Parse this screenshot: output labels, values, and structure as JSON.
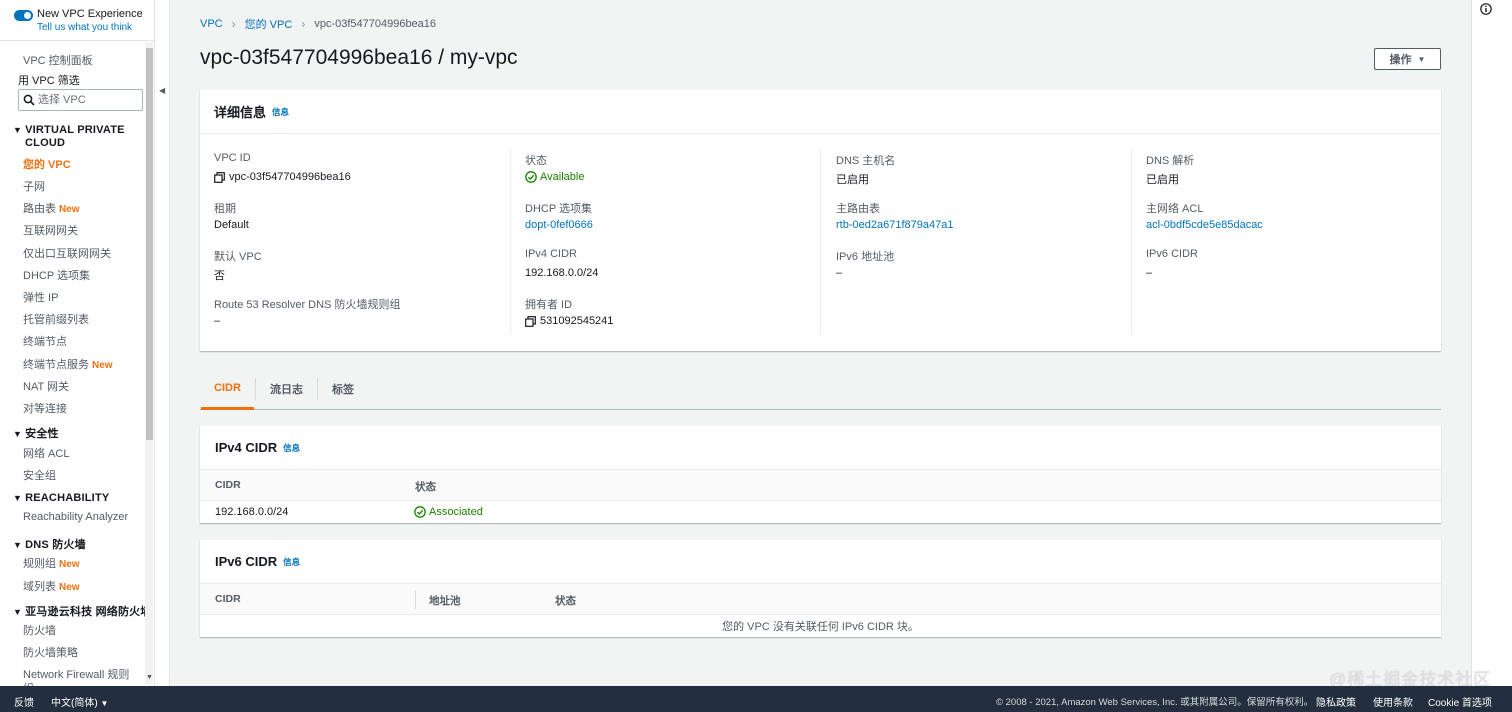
{
  "sidebar": {
    "toggle_title": "New VPC Experience",
    "toggle_sub": "Tell us what you think",
    "dashboard": "VPC 控制面板",
    "filter_label": "用 VPC 筛选",
    "search_placeholder": "选择 VPC",
    "section_vpc": "VIRTUAL PRIVATE",
    "section_vpc2": "CLOUD",
    "items_vpc": [
      "您的 VPC",
      "子网",
      "路由表",
      "互联网网关",
      "仅出口互联网网关",
      "DHCP 选项集",
      "弹性 IP",
      "托管前缀列表",
      "终端节点",
      "终端节点服务",
      "NAT 网关",
      "对等连接"
    ],
    "new_badge": "New",
    "section_security": "安全性",
    "items_security": [
      "网络 ACL",
      "安全组"
    ],
    "section_reach": "REACHABILITY",
    "items_reach": [
      "Reachability Analyzer"
    ],
    "section_dns": "DNS 防火墙",
    "items_dns": [
      "规则组",
      "域列表"
    ],
    "section_nfw": "亚马逊云科技 网络防火墙",
    "items_nfw": [
      "防火墙",
      "防火墙策略",
      "Network Firewall 规则",
      "组"
    ]
  },
  "breadcrumb": [
    "VPC",
    "您的 VPC",
    "vpc-03f547704996bea16"
  ],
  "page_title": "vpc-03f547704996bea16 / my-vpc",
  "actions_label": "操作",
  "details": {
    "title": "详细信息",
    "info": "信息",
    "vpc_id_label": "VPC ID",
    "vpc_id": "vpc-03f547704996bea16",
    "tenancy_label": "租期",
    "tenancy": "Default",
    "default_vpc_label": "默认 VPC",
    "default_vpc": "否",
    "route53_label": "Route 53 Resolver DNS 防火墙规则组",
    "route53": "–",
    "state_label": "状态",
    "state": "Available",
    "dhcp_label": "DHCP 选项集",
    "dhcp": "dopt-0fef0666",
    "ipv4_label": "IPv4 CIDR",
    "ipv4": "192.168.0.0/24",
    "owner_label": "拥有者 ID",
    "owner": "531092545241",
    "dns_host_label": "DNS 主机名",
    "dns_host": "已启用",
    "main_rt_label": "主路由表",
    "main_rt": "rtb-0ed2a671f879a47a1",
    "ipv6_pool_label": "IPv6 地址池",
    "ipv6_pool": "–",
    "dns_res_label": "DNS 解析",
    "dns_res": "已启用",
    "main_acl_label": "主网络 ACL",
    "main_acl": "acl-0bdf5cde5e85dacac",
    "ipv6_cidr_label": "IPv6 CIDR",
    "ipv6_cidr": "–"
  },
  "tabs": [
    "CIDR",
    "流日志",
    "标签"
  ],
  "ipv4_table": {
    "title": "IPv4 CIDR",
    "info": "信息",
    "headers": [
      "CIDR",
      "状态"
    ],
    "rows": [
      {
        "cidr": "192.168.0.0/24",
        "status": "Associated"
      }
    ]
  },
  "ipv6_table": {
    "title": "IPv6 CIDR",
    "info": "信息",
    "headers": [
      "CIDR",
      "地址池",
      "状态"
    ],
    "empty": "您的 VPC 没有关联任何 IPv6 CIDR 块。"
  },
  "footer": {
    "feedback": "反馈",
    "language": "中文(简体)",
    "copyright": "© 2008 - 2021, Amazon Web Services, Inc. 或其附属公司。保留所有权利。",
    "privacy": "隐私政策",
    "terms": "使用条款",
    "cookie": "Cookie 首选项"
  },
  "watermark": "@稀土掘金技术社区",
  "colors": {
    "accent": "#ec7211",
    "link": "#0073bb",
    "success": "#1d8102",
    "footer_bg": "#232f3e"
  }
}
